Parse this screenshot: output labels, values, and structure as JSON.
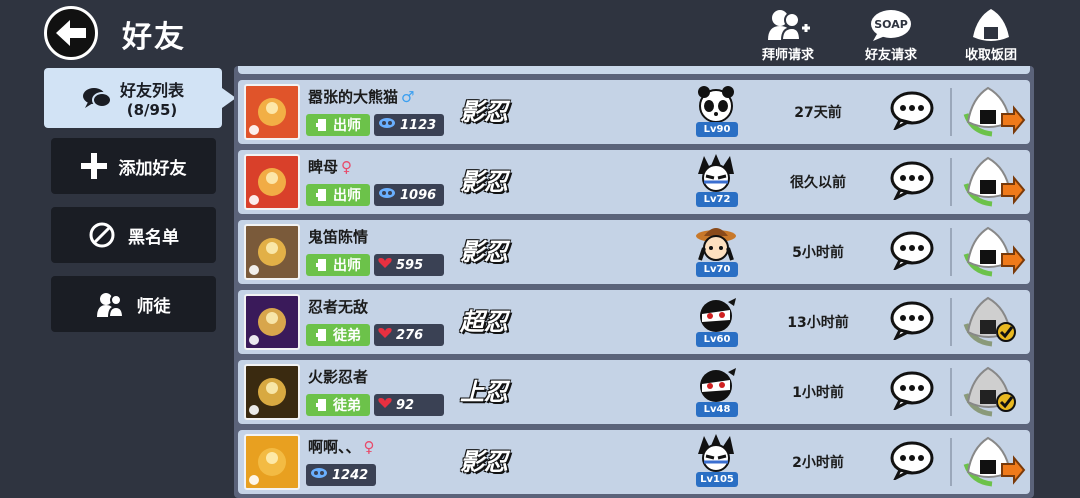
{
  "header": {
    "title": "好友",
    "actions": [
      {
        "label": "拜师请求",
        "icon": "users-plus-icon"
      },
      {
        "label": "好友请求",
        "icon": "soap-bubble-icon"
      },
      {
        "label": "收取饭团",
        "icon": "rice-ball-icon"
      }
    ]
  },
  "nav": {
    "active": {
      "label": "好友列表",
      "count": "(8/95)",
      "icon": "chat-bubbles-icon"
    },
    "items": [
      {
        "label": "添加好友",
        "icon": "plus-icon"
      },
      {
        "label": "黑名单",
        "icon": "ban-icon"
      },
      {
        "label": "师徒",
        "icon": "master-apprentice-icon"
      }
    ]
  },
  "friends": [
    {
      "name": "嚣张的大熊猫",
      "gender": "♂",
      "gender_color": "#3b9ff0",
      "tag": "出师",
      "stat_type": "swirl",
      "stat": "1123",
      "rank": "影忍",
      "level": "Lv90",
      "time": "27天前",
      "gift": "send",
      "avatar_color": "#e0542a",
      "char": "panda"
    },
    {
      "name": "睥母",
      "gender": "♀",
      "gender_color": "#e84a6a",
      "tag": "出师",
      "stat_type": "swirl",
      "stat": "1096",
      "rank": "影忍",
      "level": "Lv72",
      "time": "很久以前",
      "gift": "send",
      "avatar_color": "#d9402a",
      "char": "spiky"
    },
    {
      "name": "鬼笛陈情",
      "gender": "",
      "gender_color": "",
      "tag": "出师",
      "stat_type": "heart",
      "stat": "595",
      "rank": "影忍",
      "level": "Lv70",
      "time": "5小时前",
      "gift": "send",
      "avatar_color": "#7a5a3a",
      "char": "hat"
    },
    {
      "name": "忍者无敌",
      "gender": "",
      "gender_color": "",
      "tag": "徒弟",
      "stat_type": "heart",
      "stat": "276",
      "rank": "超忍",
      "level": "Lv60",
      "time": "13小时前",
      "gift": "claimed",
      "avatar_color": "#3a1a5a",
      "char": "ninja-red"
    },
    {
      "name": "火影忍者",
      "gender": "",
      "gender_color": "",
      "tag": "徒弟",
      "stat_type": "heart",
      "stat": "92",
      "rank": "上忍",
      "level": "Lv48",
      "time": "1小时前",
      "gift": "claimed",
      "avatar_color": "#3a2a10",
      "char": "ninja-red"
    },
    {
      "name": "啊啊、、",
      "gender": "♀",
      "gender_color": "#e84a6a",
      "tag": "",
      "stat_type": "swirl",
      "stat": "1242",
      "rank": "影忍",
      "level": "Lv105",
      "time": "2小时前",
      "gift": "send",
      "avatar_color": "#e8a020",
      "char": "spiky"
    }
  ],
  "colors": {
    "background": "#2f3440",
    "row": "#c5d3e6",
    "tag_green": "#6cc24a",
    "level_blue": "#2a6fc4",
    "accent_orange": "#f07a1a"
  }
}
